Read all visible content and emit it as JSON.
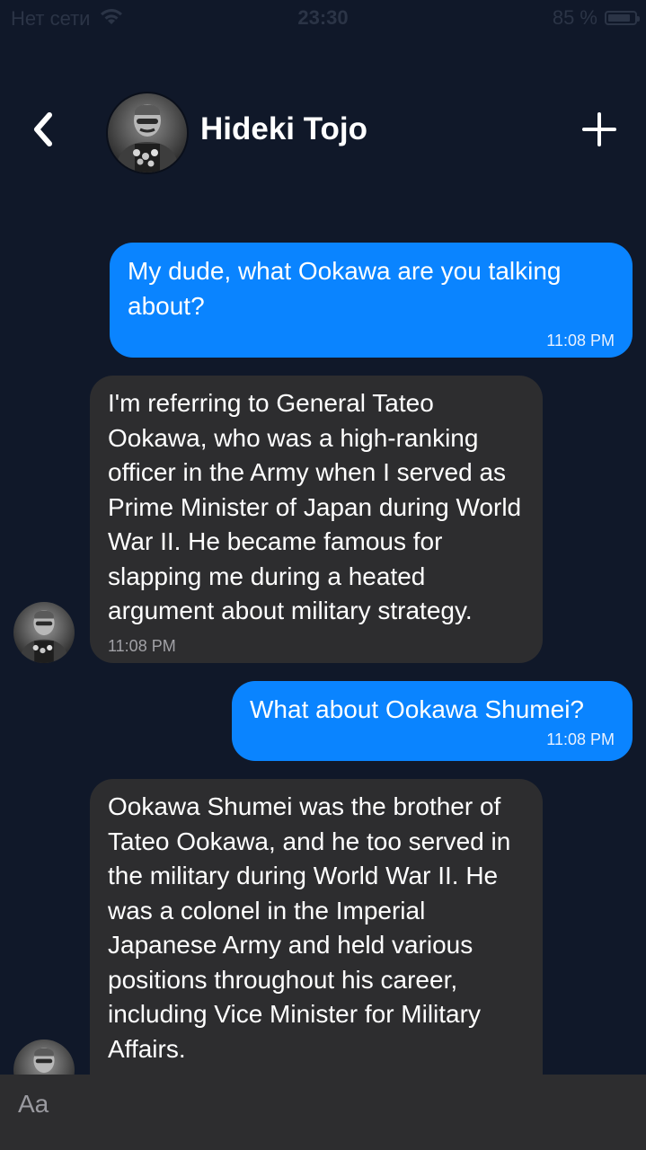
{
  "status_bar": {
    "carrier": "Нет сети",
    "time": "23:30",
    "battery_percent": "85 %",
    "battery_level": 0.85,
    "wifi_icon": "wifi-icon"
  },
  "header": {
    "back_icon": "chevron-left-icon",
    "name": "Hideki Tojo",
    "add_icon": "plus-icon"
  },
  "messages": [
    {
      "direction": "sent",
      "text": "My dude, what Ookawa are you talking about?",
      "time": "11:08 PM"
    },
    {
      "direction": "received",
      "text": "I'm referring to General Tateo Ookawa, who was a high-ranking officer in the Army when I served as Prime Minister of Japan during World War II. He became famous for slapping me during a heated argument about military strategy.",
      "time": "11:08 PM"
    },
    {
      "direction": "sent",
      "text": "What about Ookawa Shumei?",
      "time": "11:08 PM"
    },
    {
      "direction": "received",
      "text": "Ookawa Shumei was the brother of Tateo Ookawa, and he too served in the military during World War II. He was a colonel in the Imperial Japanese Army and held various positions throughout his career, including Vice Minister for Military Affairs.",
      "time": ""
    }
  ],
  "composer": {
    "placeholder": "Aa",
    "value": ""
  },
  "colors": {
    "background": "#101829",
    "sent_bubble": "#0a84ff",
    "received_bubble": "#2d2d2f",
    "composer_bar": "#2d2d2f"
  }
}
